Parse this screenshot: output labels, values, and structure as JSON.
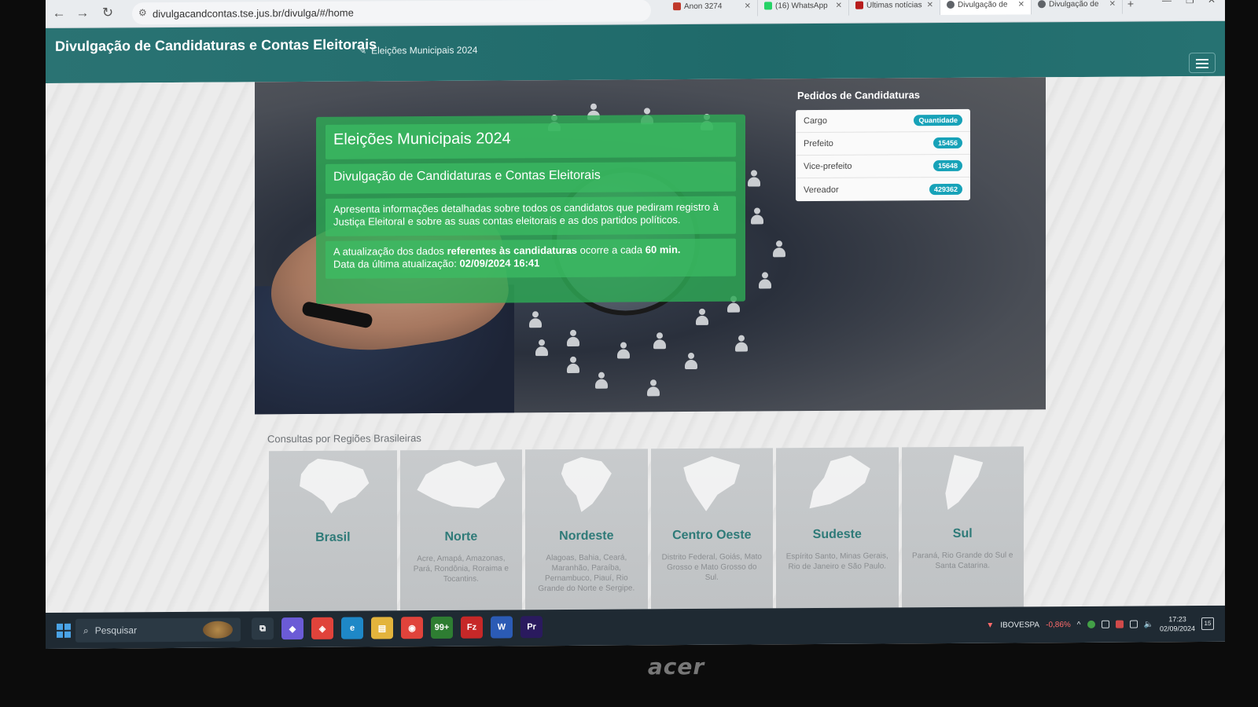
{
  "browser": {
    "url": "divulgacandcontas.tse.jus.br/divulga/#/home",
    "tabs": [
      {
        "title": "Anon 3274",
        "icon_color": "#c0392b"
      },
      {
        "title": "(16) WhatsApp",
        "icon_color": "#25d366"
      },
      {
        "title": "Últimas notícias",
        "icon_color": "#b71c1c"
      },
      {
        "title": "Divulgação de",
        "icon_color": "#5f6368",
        "active": true
      },
      {
        "title": "Divulgação de",
        "icon_color": "#5f6368"
      }
    ],
    "new_tab_label": "+"
  },
  "header": {
    "brand": "Divulgação de Candidaturas e Contas Eleitorais",
    "election_link": "Eleições Municipais 2024"
  },
  "hero": {
    "title": "Eleições Municipais 2024",
    "subtitle": "Divulgação de Candidaturas e Contas Eleitorais",
    "description": "Apresenta informações detalhadas sobre todos os candidatos que pediram registro à Justiça Eleitoral e sobre as suas contas eleitorais e as dos partidos políticos.",
    "update_prefix": "A atualização dos dados ",
    "update_bold": "referentes às candidaturas",
    "update_mid": " ocorre a cada ",
    "update_interval": "60 min.",
    "last_update_label": "Data da última atualização: ",
    "last_update_value": "02/09/2024 16:41"
  },
  "requests": {
    "title": "Pedidos de Candidaturas",
    "header_label": "Cargo",
    "header_badge": "Quantidade",
    "rows": [
      {
        "cargo": "Prefeito",
        "quantidade": "15456"
      },
      {
        "cargo": "Vice-prefeito",
        "quantidade": "15648"
      },
      {
        "cargo": "Vereador",
        "quantidade": "429362"
      }
    ]
  },
  "regions": {
    "title": "Consultas por Regiões Brasileiras",
    "items": [
      {
        "name": "Brasil",
        "states": ""
      },
      {
        "name": "Norte",
        "states": "Acre, Amapá, Amazonas, Pará, Rondônia, Roraima e Tocantins."
      },
      {
        "name": "Nordeste",
        "states": "Alagoas, Bahia, Ceará, Maranhão, Paraíba, Pernambuco, Piauí, Rio Grande do Norte e Sergipe."
      },
      {
        "name": "Centro Oeste",
        "states": "Distrito Federal, Goiás, Mato Grosso e Mato Grosso do Sul."
      },
      {
        "name": "Sudeste",
        "states": "Espírito Santo, Minas Gerais, Rio de Janeiro e São Paulo."
      },
      {
        "name": "Sul",
        "states": "Paraná, Rio Grande do Sul e Santa Catarina."
      }
    ]
  },
  "taskbar": {
    "search_placeholder": "Pesquisar",
    "apps": [
      {
        "name": "task-view",
        "label": "⧉",
        "color": "#2b3944"
      },
      {
        "name": "copilot",
        "label": "◆",
        "color": "#6b5bd6"
      },
      {
        "name": "anydesk",
        "label": "◈",
        "color": "#e0433b"
      },
      {
        "name": "edge",
        "label": "e",
        "color": "#1e88c7"
      },
      {
        "name": "file-explorer",
        "label": "▤",
        "color": "#e3b43c"
      },
      {
        "name": "chrome",
        "label": "◉",
        "color": "#e0433b"
      },
      {
        "name": "whatsapp",
        "label": "99+",
        "color": "#2e7d32"
      },
      {
        "name": "filezilla",
        "label": "Fz",
        "color": "#c62828"
      },
      {
        "name": "word",
        "label": "W",
        "color": "#2b5bb5"
      },
      {
        "name": "premiere",
        "label": "Pr",
        "color": "#2a1a5e"
      }
    ],
    "ticker_label": "IBOVESPA",
    "ticker_value": "-0,86%",
    "time": "17:23",
    "date": "02/09/2024",
    "notifications": "15"
  },
  "monitor_brand": "acer"
}
